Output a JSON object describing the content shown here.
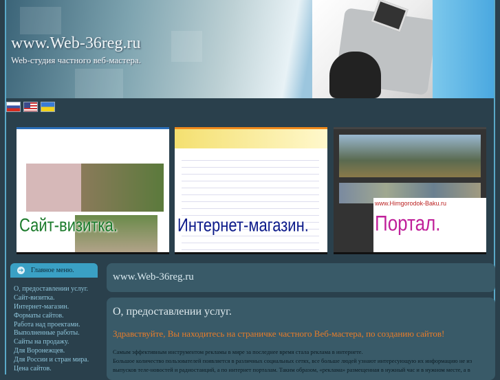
{
  "header": {
    "title": "www.Web-36reg.ru",
    "subtitle": "Web-студия частного веб-мастера."
  },
  "languages": [
    {
      "name": "russian-flag"
    },
    {
      "name": "english-flag"
    },
    {
      "name": "ukrainian-flag"
    }
  ],
  "banners": [
    {
      "caption": "Сайт-визитка.",
      "color": "#1a7a2a"
    },
    {
      "caption": "Интернет-магазин.",
      "color": "#0c1a8a"
    },
    {
      "caption": "Портал.",
      "color": "#c0209a",
      "site": "www.Himgorodok-Baku.ru"
    }
  ],
  "sidebar": {
    "header": "Главное меню.",
    "items": [
      "О, предоставлении услуг.",
      "Сайт-визитка.",
      "Интернет-магазин.",
      "Форматы сайтов.",
      "Работа над проектами.",
      "Выполненные работы.",
      "Сайты на продажу.",
      "Для Воронежцев.",
      "Для России и стран мира.",
      "Цена сайтов."
    ]
  },
  "main": {
    "site_box": "www.Web-36reg.ru",
    "heading": "О, предоставлении услуг.",
    "welcome": "Здравствуйте, Вы находитесь на страничке частного Веб-мастера, по созданию сайтов!",
    "paragraphs": [
      "Самым эффективным инструментом рекламы в мире за последнее время стала реклама в интернете.",
      "Большое количество пользователей появляется в различных социальных сетях, все больше людей узнают интересующую их информацию не из выпусков теле-новостей и радиостанций, а по  интернет порталам. Таким образом, «реклама»  размещенная в нужный час и в нужном месте, а в"
    ]
  },
  "colors": {
    "accent": "#3aa0c4",
    "welcome": "#e87d2a",
    "bg": "#2a404c"
  }
}
